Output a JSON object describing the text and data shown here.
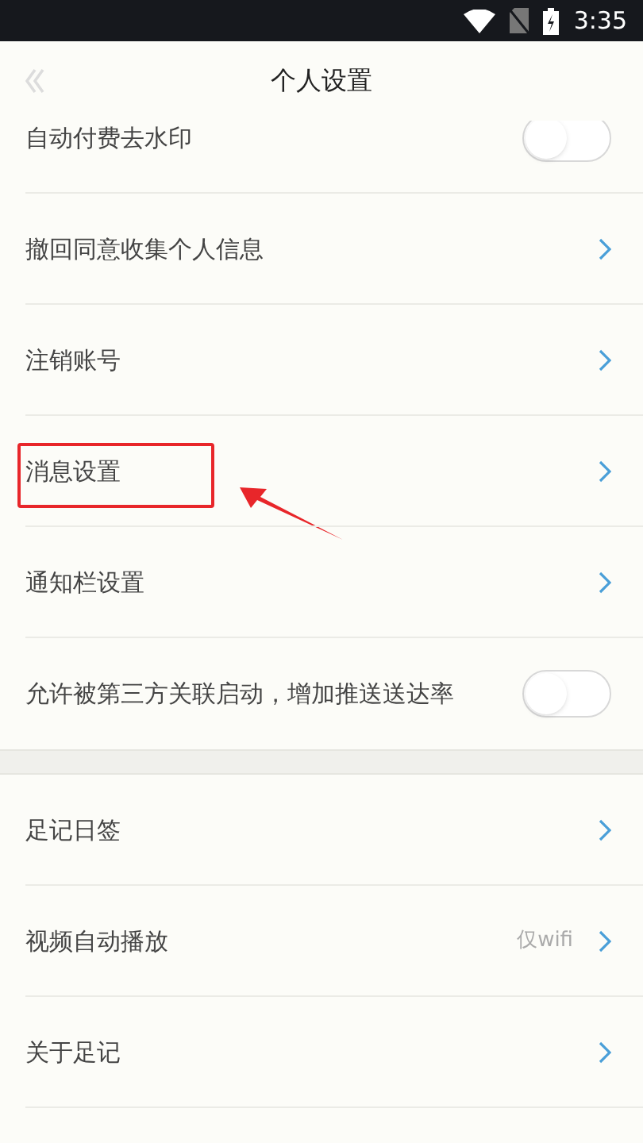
{
  "status_bar": {
    "time": "3:35"
  },
  "header": {
    "title": "个人设置",
    "back_disabled": true
  },
  "sections": [
    {
      "items": [
        {
          "kind": "toggle",
          "label": "自动付费去水印",
          "on": false
        },
        {
          "kind": "link",
          "label": "撤回同意收集个人信息"
        },
        {
          "kind": "link",
          "label": "注销账号"
        },
        {
          "kind": "link",
          "label": "消息设置",
          "highlighted": true
        },
        {
          "kind": "link",
          "label": "通知栏设置"
        },
        {
          "kind": "toggle",
          "label": "允许被第三方关联启动，增加推送送达率",
          "on": false
        }
      ]
    },
    {
      "items": [
        {
          "kind": "link",
          "label": "足记日签"
        },
        {
          "kind": "link",
          "label": "视频自动播放",
          "value": "仅wifi"
        },
        {
          "kind": "link",
          "label": "关于足记"
        }
      ]
    }
  ]
}
